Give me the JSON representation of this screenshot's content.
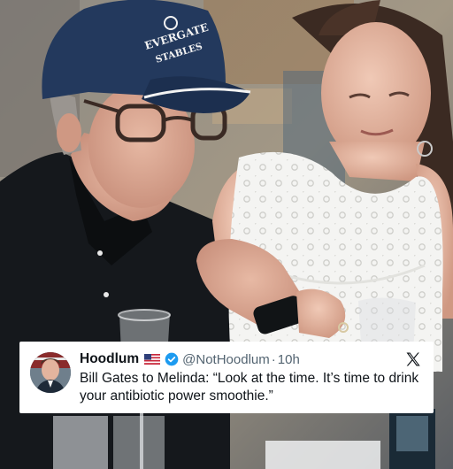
{
  "tweet": {
    "name": "Hoodlum",
    "handle": "@NotHoodlum",
    "separator": "·",
    "time": "10h",
    "text": "Bill Gates to Melinda: “Look at the time. It’s time to drink your antibiotic power smoothie.”",
    "flag_icon": "us-flag-icon",
    "verified_icon": "verified-badge-icon",
    "logo_icon": "x-logo-icon",
    "verified_color": "#1d9bf0"
  },
  "photo": {
    "cap_text": "EVERGATE STABLES",
    "cap_color": "#23395d"
  }
}
